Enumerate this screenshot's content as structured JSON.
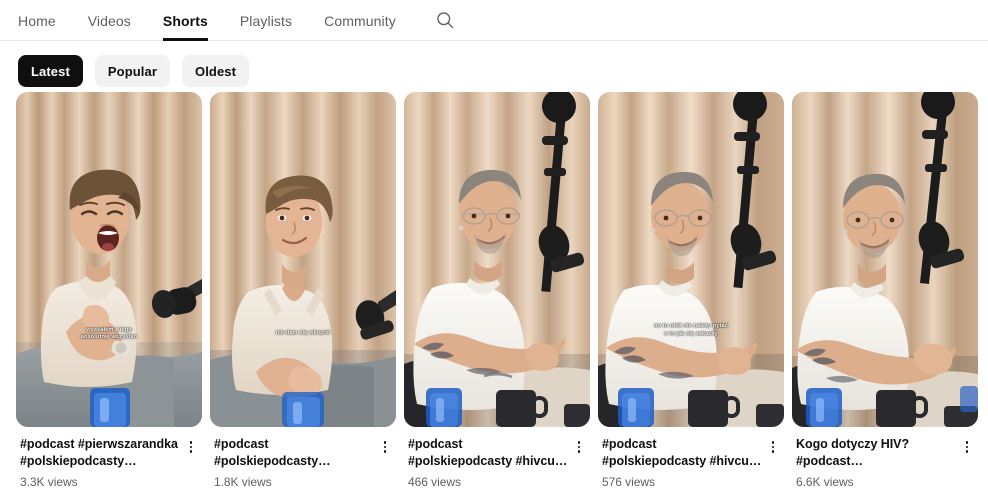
{
  "nav": {
    "tabs": [
      {
        "label": "Home",
        "active": false
      },
      {
        "label": "Videos",
        "active": false
      },
      {
        "label": "Shorts",
        "active": true
      },
      {
        "label": "Playlists",
        "active": false
      },
      {
        "label": "Community",
        "active": false
      }
    ],
    "search_icon": "search-icon"
  },
  "filters": {
    "chips": [
      {
        "label": "Latest",
        "active": true
      },
      {
        "label": "Popular",
        "active": false
      },
      {
        "label": "Oldest",
        "active": false
      }
    ]
  },
  "colors": {
    "active_chip_bg": "#0f0f0f",
    "chip_bg": "#f2f2f2",
    "text_primary": "#0f0f0f",
    "text_secondary": "#606060",
    "page_bg": "#ffffff",
    "divider": "#e5e5e5"
  },
  "shorts": [
    {
      "title": "#podcast #pierwszarandka #polskiepodcasty #dziecko…",
      "views": "3.3K views",
      "caption": "wyssałem z tego\nabsolutnie wszystko",
      "caption_top_pct": 70,
      "menu_icon": "kebab-menu-icon"
    },
    {
      "title": "#podcast #polskiepodcasty #pierwszarandka…",
      "views": "1.8K views",
      "caption": "nie dam się wkręcić",
      "caption_top_pct": 71,
      "menu_icon": "kebab-menu-icon"
    },
    {
      "title": "#podcast #polskiepodcasty #hivcure #pierwszarandka…",
      "views": "466 views",
      "caption": "",
      "caption_top_pct": 70,
      "menu_icon": "kebab-menu-icon"
    },
    {
      "title": "#podcast #polskiepodcasty #hivcure #hiv…",
      "views": "576 views",
      "caption": "no to otóż nie należy pytać\no to jak się zakaziły",
      "caption_top_pct": 69,
      "menu_icon": "kebab-menu-icon"
    },
    {
      "title": "Kogo dotyczy HIV? #podcast #polskiepodcasty #hiv…",
      "views": "6.6K views",
      "caption": "",
      "caption_top_pct": 70,
      "menu_icon": "kebab-menu-icon"
    }
  ]
}
